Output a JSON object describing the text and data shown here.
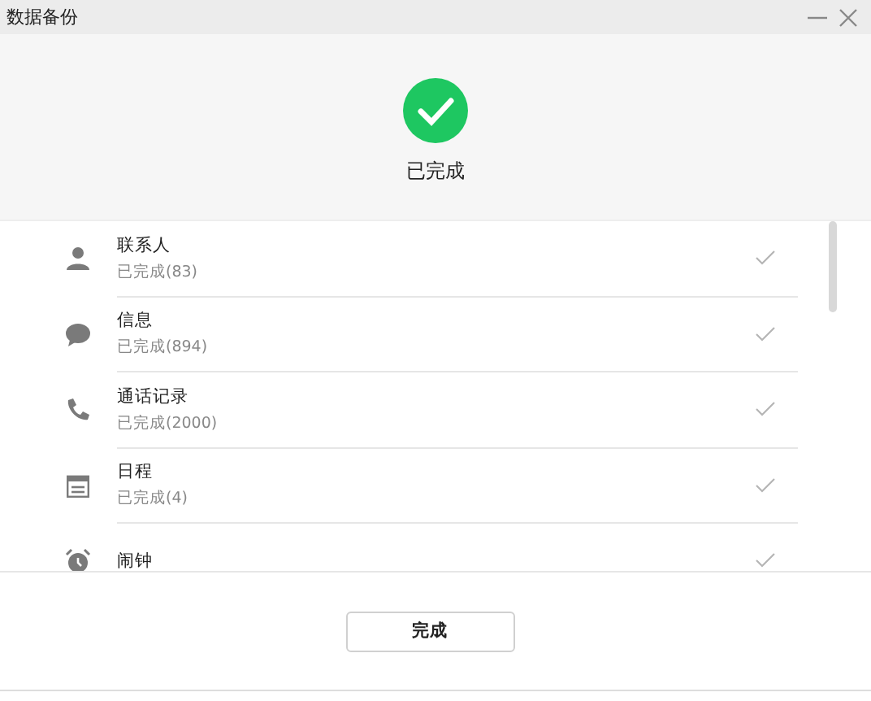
{
  "window": {
    "title": "数据备份"
  },
  "status": {
    "done": true,
    "label": "已完成"
  },
  "items": [
    {
      "kind": "contacts",
      "name": "联系人",
      "detail": "已完成(83)",
      "done": true
    },
    {
      "kind": "messages",
      "name": "信息",
      "detail": "已完成(894)",
      "done": true
    },
    {
      "kind": "calls",
      "name": "通话记录",
      "detail": "已完成(2000)",
      "done": true
    },
    {
      "kind": "calendar",
      "name": "日程",
      "detail": "已完成(4)",
      "done": true
    },
    {
      "kind": "alarm",
      "name": "闹钟",
      "done": true
    }
  ],
  "button": "完成"
}
